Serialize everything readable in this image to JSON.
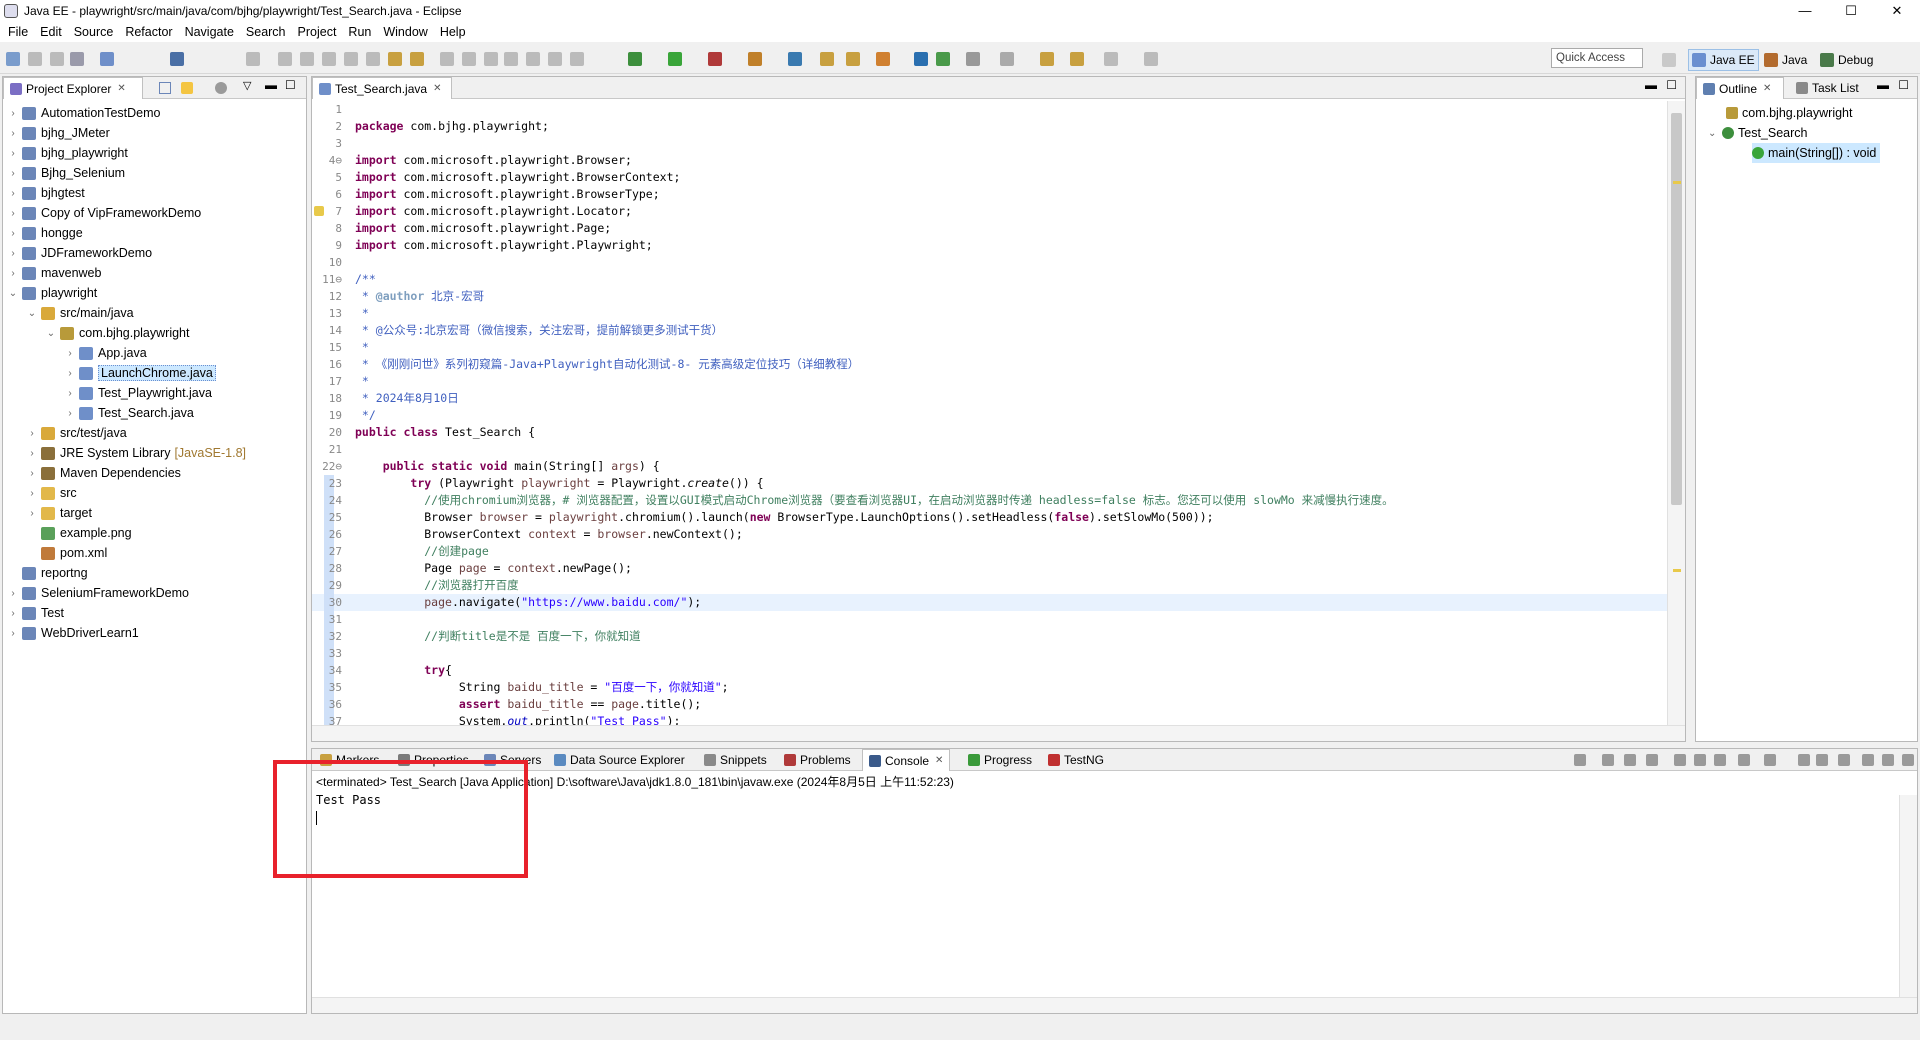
{
  "window": {
    "title": "Java EE - playwright/src/main/java/com/bjhg/playwright/Test_Search.java - Eclipse"
  },
  "menu": [
    "File",
    "Edit",
    "Source",
    "Refactor",
    "Navigate",
    "Search",
    "Project",
    "Run",
    "Window",
    "Help"
  ],
  "window_controls": {
    "minimize": "—",
    "maximize": "☐",
    "close": "✕"
  },
  "toolbar": {
    "quick_access_placeholder": "Quick Access"
  },
  "perspectives": [
    "Java EE",
    "Java",
    "Debug"
  ],
  "project_explorer": {
    "tab_label": "Project Explorer",
    "items": [
      {
        "label": "AutomationTestDemo",
        "depth": 0,
        "expanded": false,
        "icon": "project-icon"
      },
      {
        "label": "bjhg_JMeter",
        "depth": 0,
        "expanded": false,
        "icon": "project-icon"
      },
      {
        "label": "bjhg_playwright",
        "depth": 0,
        "expanded": false,
        "icon": "project-icon"
      },
      {
        "label": "Bjhg_Selenium",
        "depth": 0,
        "expanded": false,
        "icon": "project-icon"
      },
      {
        "label": "bjhgtest",
        "depth": 0,
        "expanded": false,
        "icon": "project-icon"
      },
      {
        "label": "Copy of VipFrameworkDemo",
        "depth": 0,
        "expanded": false,
        "icon": "project-icon"
      },
      {
        "label": "hongge",
        "depth": 0,
        "expanded": false,
        "icon": "project-icon"
      },
      {
        "label": "JDFrameworkDemo",
        "depth": 0,
        "expanded": false,
        "icon": "project-icon"
      },
      {
        "label": "mavenweb",
        "depth": 0,
        "expanded": false,
        "icon": "project-icon"
      },
      {
        "label": "playwright",
        "depth": 0,
        "expanded": true,
        "icon": "project-icon"
      },
      {
        "label": "src/main/java",
        "depth": 1,
        "expanded": true,
        "icon": "source-folder-icon"
      },
      {
        "label": "com.bjhg.playwright",
        "depth": 2,
        "expanded": true,
        "icon": "package-icon"
      },
      {
        "label": "App.java",
        "depth": 3,
        "expanded": false,
        "icon": "java-file-icon"
      },
      {
        "label": "LaunchChrome.java",
        "depth": 3,
        "expanded": false,
        "icon": "java-file-icon",
        "selected": true
      },
      {
        "label": "Test_Playwright.java",
        "depth": 3,
        "expanded": false,
        "icon": "java-file-icon"
      },
      {
        "label": "Test_Search.java",
        "depth": 3,
        "expanded": false,
        "icon": "java-file-icon"
      },
      {
        "label": "src/test/java",
        "depth": 1,
        "expanded": false,
        "icon": "source-folder-icon"
      },
      {
        "label": "JRE System Library",
        "suffix": "[JavaSE-1.8]",
        "depth": 1,
        "expanded": false,
        "icon": "library-icon"
      },
      {
        "label": "Maven Dependencies",
        "depth": 1,
        "expanded": false,
        "icon": "library-icon"
      },
      {
        "label": "src",
        "depth": 1,
        "expanded": false,
        "icon": "folder-icon"
      },
      {
        "label": "target",
        "depth": 1,
        "expanded": false,
        "icon": "folder-icon"
      },
      {
        "label": "example.png",
        "depth": 1,
        "leaf": true,
        "icon": "image-file-icon"
      },
      {
        "label": "pom.xml",
        "depth": 1,
        "leaf": true,
        "icon": "xml-file-icon"
      },
      {
        "label": "reportng",
        "depth": 0,
        "leaf": true,
        "icon": "project-icon"
      },
      {
        "label": "SeleniumFrameworkDemo",
        "depth": 0,
        "expanded": false,
        "icon": "project-icon"
      },
      {
        "label": "Test",
        "depth": 0,
        "expanded": false,
        "icon": "project-icon"
      },
      {
        "label": "WebDriverLearn1",
        "depth": 0,
        "expanded": false,
        "icon": "project-icon"
      }
    ]
  },
  "editor": {
    "tab_label": "Test_Search.java",
    "lines": [
      {
        "n": "1",
        "html": ""
      },
      {
        "n": "2",
        "html": "<span class='kw'>package</span> com.bjhg.playwright;"
      },
      {
        "n": "3",
        "html": ""
      },
      {
        "n": "4⊖",
        "html": "<span class='kw'>import</span> com.microsoft.playwright.Browser;"
      },
      {
        "n": "5",
        "html": "<span class='kw'>import</span> com.microsoft.playwright.BrowserContext;"
      },
      {
        "n": "6",
        "html": "<span class='kw'>import</span> com.microsoft.playwright.BrowserType;"
      },
      {
        "n": "7",
        "html": "<span class='kw'>import</span> com.microsoft.playwright.Locator;"
      },
      {
        "n": "8",
        "html": "<span class='kw'>import</span> com.microsoft.playwright.Page;"
      },
      {
        "n": "9",
        "html": "<span class='kw'>import</span> com.microsoft.playwright.Playwright;"
      },
      {
        "n": "10",
        "html": ""
      },
      {
        "n": "11⊖",
        "html": "<span class='jd'>/**</span>"
      },
      {
        "n": "12",
        "html": "<span class='jd'> * <b style='color:#7f9fbf'>@author</b> 北京-宏哥</span>"
      },
      {
        "n": "13",
        "html": "<span class='jd'> *</span>"
      },
      {
        "n": "14",
        "html": "<span class='jd'> * @公众号:北京宏哥（微信搜索，关注宏哥，提前解锁更多测试干货）</span>"
      },
      {
        "n": "15",
        "html": "<span class='jd'> *</span>"
      },
      {
        "n": "16",
        "html": "<span class='jd'> * 《刚刚问世》系列初窥篇-Java+Playwright自动化测试-8- 元素高级定位技巧（详细教程）</span>"
      },
      {
        "n": "17",
        "html": "<span class='jd'> *</span>"
      },
      {
        "n": "18",
        "html": "<span class='jd'> * 2024年8月10日</span>"
      },
      {
        "n": "19",
        "html": "<span class='jd'> */</span>"
      },
      {
        "n": "20",
        "html": "<span class='kw'>public class</span> Test_Search {"
      },
      {
        "n": "21",
        "html": ""
      },
      {
        "n": "22⊖",
        "html": "    <span class='kw'>public static void</span> main(String[] <span class='var'>args</span>) {"
      },
      {
        "n": "23",
        "html": "        <span class='kw'>try</span> (Playwright <span class='var'>playwright</span> = Playwright.<i>create</i>()) {"
      },
      {
        "n": "24",
        "html": "          <span class='cm'>//使用chromium浏览器，# 浏览器配置，设置以GUI模式启动Chrome浏览器（要查看浏览器UI，在启动浏览器时传递 headless=false 标志。您还可以使用 slowMo 来减慢执行速度。</span>"
      },
      {
        "n": "25",
        "html": "          Browser <span class='var'>browser</span> = <span class='var'>playwright</span>.chromium().launch(<span class='kw'>new</span> BrowserType.LaunchOptions().setHeadless(<span class='kw'>false</span>).setSlowMo(500));"
      },
      {
        "n": "26",
        "html": "          BrowserContext <span class='var'>context</span> = <span class='var'>browser</span>.newContext();"
      },
      {
        "n": "27",
        "html": "          <span class='cm'>//创建page</span>"
      },
      {
        "n": "28",
        "html": "          Page <span class='var'>page</span> = <span class='var'>context</span>.newPage();"
      },
      {
        "n": "29",
        "html": "          <span class='cm'>//浏览器打开百度</span>"
      },
      {
        "n": "30",
        "html": "          <span class='var'>page</span>.navigate(<span class='str'>\"https://www.baidu.com/\"</span>);"
      },
      {
        "n": "31",
        "html": ""
      },
      {
        "n": "32",
        "html": "          <span class='cm'>//判断title是不是 百度一下，你就知道</span>"
      },
      {
        "n": "33",
        "html": ""
      },
      {
        "n": "34",
        "html": "          <span class='kw'>try</span>{"
      },
      {
        "n": "35",
        "html": "               String <span class='var'>baidu_title</span> = <span class='str'>\"百度一下，你就知道\"</span>;"
      },
      {
        "n": "36",
        "html": "               <span class='kw'>assert</span> <span class='var'>baidu_title</span> == <span class='var'>page</span>.title();"
      },
      {
        "n": "37",
        "html": "               System.<i style='color:#0000c0'>out</i>.println(<span class='str'>\"Test Pass\"</span>);"
      }
    ],
    "highlight_line": "30"
  },
  "outline": {
    "tabs": [
      "Outline",
      "Task List"
    ],
    "items": [
      {
        "label": "com.bjhg.playwright",
        "icon": "package-icon"
      },
      {
        "label": "Test_Search",
        "icon": "class-icon"
      },
      {
        "label": "main(String[]) : void",
        "icon": "method-icon"
      }
    ]
  },
  "bottom_panel": {
    "tabs": [
      "Markers",
      "Properties",
      "Servers",
      "Data Source Explorer",
      "Snippets",
      "Problems",
      "Console",
      "Progress",
      "TestNG"
    ],
    "active_tab": "Console",
    "console_header": "<terminated> Test_Search [Java Application] D:\\software\\Java\\jdk1.8.0_181\\bin\\javaw.exe (2024年8月5日 上午11:52:23)",
    "output": "Test Pass"
  },
  "colors": {
    "annotation_red": "#e8212b",
    "selection": "#cce8ff",
    "highlight_line": "#e8f2fe"
  }
}
